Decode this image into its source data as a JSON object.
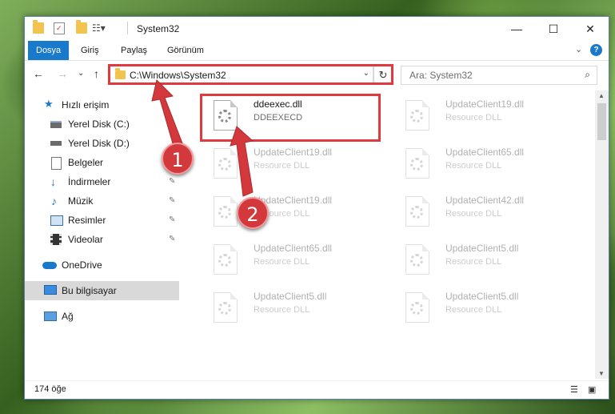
{
  "window": {
    "title": "System32",
    "controls": {
      "minimize": "—",
      "maximize": "☐",
      "close": "✕"
    }
  },
  "ribbon": {
    "tabs": [
      "Dosya",
      "Giriş",
      "Paylaş",
      "Görünüm"
    ],
    "expand_icon": "⌄",
    "help_icon": "?"
  },
  "nav": {
    "back": "←",
    "forward": "→",
    "recent": "⌄",
    "up": "↑",
    "address": "C:\\Windows\\System32",
    "refresh": "↻",
    "search_placeholder": "Ara: System32"
  },
  "sidebar": {
    "items": [
      {
        "label": "Hızlı erişim",
        "icon": "star-icon",
        "pinned": false,
        "selected": false
      },
      {
        "label": "Yerel Disk (C:)",
        "icon": "drive-icon",
        "pinned": false,
        "selected": false
      },
      {
        "label": "Yerel Disk (D:)",
        "icon": "drive-icon",
        "pinned": false,
        "selected": false
      },
      {
        "label": "Belgeler",
        "icon": "documents-icon",
        "pinned": false,
        "selected": false
      },
      {
        "label": "İndirmeler",
        "icon": "downloads-icon",
        "pinned": true,
        "selected": false
      },
      {
        "label": "Müzik",
        "icon": "music-icon",
        "pinned": true,
        "selected": false
      },
      {
        "label": "Resimler",
        "icon": "pictures-icon",
        "pinned": true,
        "selected": false
      },
      {
        "label": "Videolar",
        "icon": "videos-icon",
        "pinned": true,
        "selected": false
      },
      {
        "label": "OneDrive",
        "icon": "cloud-icon",
        "pinned": false,
        "selected": false
      },
      {
        "label": "Bu bilgisayar",
        "icon": "computer-icon",
        "pinned": false,
        "selected": true
      },
      {
        "label": "Ağ",
        "icon": "network-icon",
        "pinned": false,
        "selected": false
      }
    ],
    "pin_glyph": "📌"
  },
  "files": [
    {
      "name": "ddeexec.dll",
      "type": "DDEEXECD",
      "faded": false
    },
    {
      "name": "UpdateClient19.dll",
      "type": "Resource DLL",
      "faded": true
    },
    {
      "name": "UpdateClient19.dll",
      "type": "Resource DLL",
      "faded": true
    },
    {
      "name": "UpdateClient65.dll",
      "type": "Resource DLL",
      "faded": true
    },
    {
      "name": "UpdateClient19.dll",
      "type": "Resource DLL",
      "faded": true
    },
    {
      "name": "UpdateClient42.dll",
      "type": "Resource DLL",
      "faded": true
    },
    {
      "name": "UpdateClient65.dll",
      "type": "Resource DLL",
      "faded": true
    },
    {
      "name": "UpdateClient5.dll",
      "type": "Resource DLL",
      "faded": true
    },
    {
      "name": "UpdateClient5.dll",
      "type": "Resource DLL",
      "faded": true
    },
    {
      "name": "UpdateClient5.dll",
      "type": "Resource DLL",
      "faded": true
    }
  ],
  "status": {
    "item_count": "174 öğe"
  },
  "annotations": {
    "step1": "1",
    "step2": "2",
    "accent": "#d3383c"
  },
  "colors": {
    "ribbon_active": "#1979ca",
    "highlight": "#e03a3e"
  }
}
